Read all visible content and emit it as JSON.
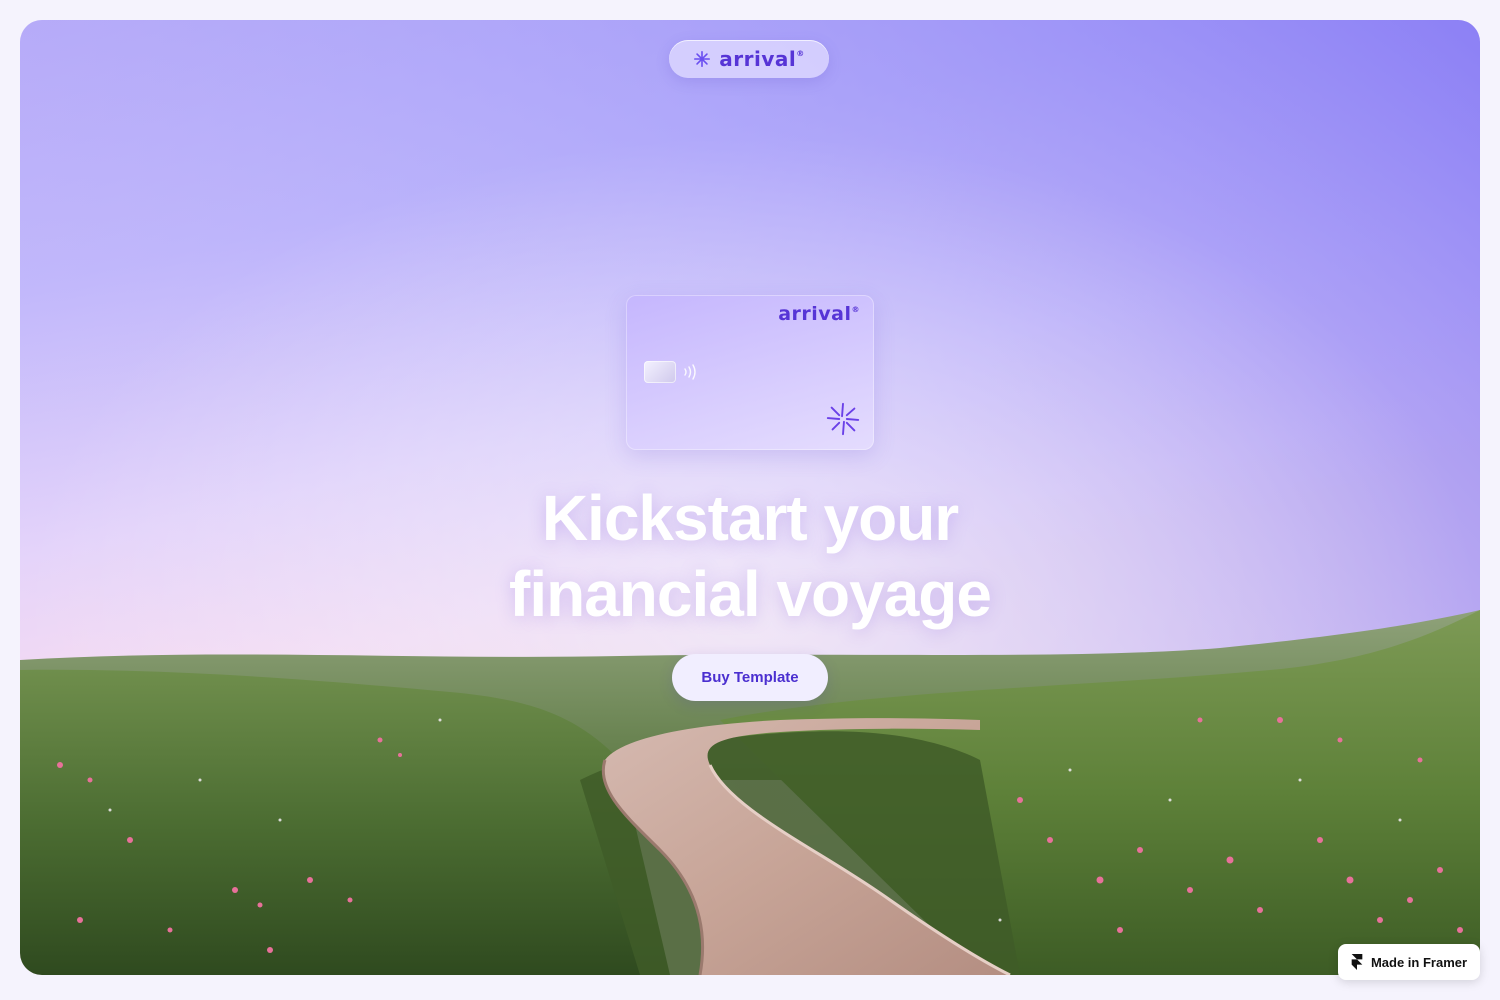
{
  "brand": {
    "name": "arrival",
    "registered_mark": "®"
  },
  "hero": {
    "headline_line1": "Kickstart your",
    "headline_line2": "financial voyage",
    "cta_label": "Buy Template"
  },
  "card": {
    "brand_name": "arrival",
    "registered_mark": "®"
  },
  "badge": {
    "label": "Made in Framer"
  },
  "icons": {
    "nav_logo": "asterisk-star-icon",
    "card_chip": "card-chip-icon",
    "contactless": "contactless-icon",
    "card_mark": "burst-star-icon",
    "framer": "framer-logo-icon"
  },
  "colors": {
    "brand_purple": "#5634d6",
    "button_text": "#4b2fd0",
    "button_bg": "#f1eeff",
    "sky_top": "#8f8cf7",
    "sky_horizon": "#f3d6f2"
  }
}
